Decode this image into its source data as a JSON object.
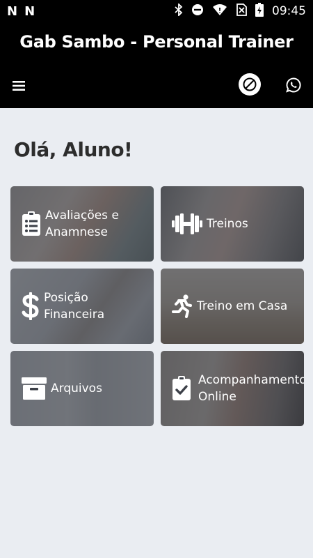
{
  "status_bar": {
    "time": "09:45",
    "left_icons": [
      "N",
      "N"
    ],
    "right_icons": [
      "bluetooth-icon",
      "do-not-disturb-icon",
      "wifi-icon",
      "no-sim-icon",
      "battery-charging-icon"
    ]
  },
  "header": {
    "title": "Gab Sambo - Personal Trainer",
    "icons": [
      "menu-icon",
      "block-icon",
      "whatsapp-icon"
    ]
  },
  "greeting": "Olá, Aluno!",
  "cards": [
    {
      "label_line1": "Avaliações e",
      "label_line2": "Anamnese",
      "icon": "clipboard-list-icon"
    },
    {
      "label_line1": "Treinos",
      "label_line2": "",
      "icon": "dumbbell-icon"
    },
    {
      "label_line1": "Posição",
      "label_line2": "Financeira",
      "icon": "dollar-icon"
    },
    {
      "label_line1": "Treino em Casa",
      "label_line2": "",
      "icon": "running-icon"
    },
    {
      "label_line1": "Arquivos",
      "label_line2": "",
      "icon": "archive-icon"
    },
    {
      "label_line1": "Acompanhamento",
      "label_line2": "Online",
      "icon": "clipboard-check-icon"
    }
  ],
  "colors": {
    "header_bg": "#000000",
    "page_bg": "#eaedf2",
    "card_overlay": "#282c34"
  }
}
